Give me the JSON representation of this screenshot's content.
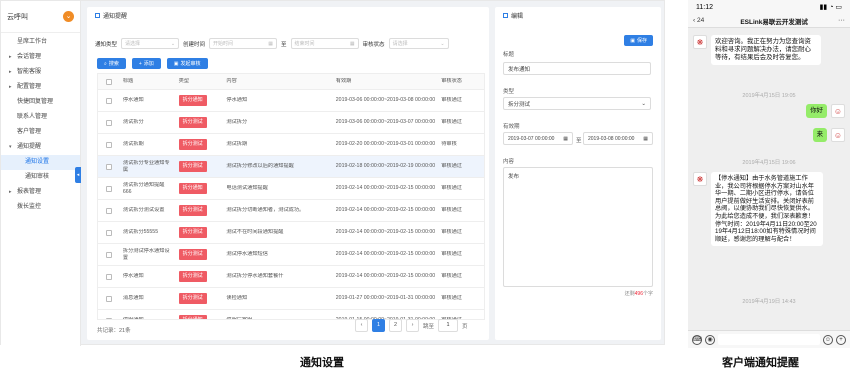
{
  "sidebar": {
    "brand": "云呼叫",
    "badge": "⌄",
    "items": [
      {
        "label": "呈席工作台",
        "arrow": ""
      },
      {
        "label": "会话管理",
        "arrow": "▸"
      },
      {
        "label": "智能客服",
        "arrow": "▸"
      },
      {
        "label": "配置管理",
        "arrow": "▸"
      },
      {
        "label": "快捷回复管理",
        "arrow": ""
      },
      {
        "label": "联系人管理",
        "arrow": ""
      },
      {
        "label": "客户管理",
        "arrow": ""
      },
      {
        "label": "通知提醒",
        "arrow": "▾"
      },
      {
        "label": "通知设置",
        "arrow": ""
      },
      {
        "label": "通知审核",
        "arrow": ""
      },
      {
        "label": "报表管理",
        "arrow": "▸"
      },
      {
        "label": "拨长监控",
        "arrow": ""
      }
    ]
  },
  "main": {
    "title": "通知提醒",
    "filters": {
      "type_label": "通知类型",
      "type_ph": "请选择",
      "create_label": "创建时间",
      "start_ph": "开始时间",
      "to": "至",
      "end_ph": "结束时间",
      "review_label": "审核状态",
      "review_ph": "请选择"
    },
    "buttons": {
      "search": "搜索",
      "add": "添加",
      "publish": "发起审核"
    },
    "columns": [
      "",
      "标题",
      "类型",
      "内容",
      "有效期",
      "审核状态"
    ],
    "rows": [
      {
        "title": "停水通知",
        "type": "拆分通知",
        "content": "停水通知",
        "period": "2019-03-06 00:00:00~2019-03-08 00:00:00",
        "status": "审核通过"
      },
      {
        "title": "测试拆分",
        "type": "拆分测试",
        "content": "测试拆分",
        "period": "2019-03-06 00:00:00~2019-03-07 00:00:00",
        "status": "审核通过"
      },
      {
        "title": "测试拆期",
        "type": "拆分测试",
        "content": "测试拆期",
        "period": "2019-02-20 00:00:00~2019-03-01 00:00:00",
        "status": "待审核"
      },
      {
        "title": "测试拆分专业通知专属",
        "type": "拆分测试",
        "content": "测试拆分修改以后的通知提醒",
        "period": "2019-02-18 00:00:00~2019-02-19 00:00:00",
        "status": "审核通过"
      },
      {
        "title": "测试拆分通知提醒666",
        "type": "拆分通知",
        "content": "电话测试通知提醒",
        "period": "2019-02-14 00:00:00~2019-02-15 00:00:00",
        "status": "审核通过"
      },
      {
        "title": "测试拆分测试设置",
        "type": "拆分测试",
        "content": "测试拆分切断通知者，测试成功。",
        "period": "2019-02-14 00:00:00~2019-02-15 00:00:00",
        "status": "审核通过"
      },
      {
        "title": "测试拆分55555",
        "type": "拆分测试",
        "content": "测试不在时间段通知提醒",
        "period": "2019-02-14 00:00:00~2019-02-15 00:00:00",
        "status": "审核通过"
      },
      {
        "title": "拆分测试停水通知设置",
        "type": "拆分测试",
        "content": "测试停水通知短信",
        "period": "2019-02-14 00:00:00~2019-02-15 00:00:00",
        "status": "审核通过"
      },
      {
        "title": "停水通知",
        "type": "拆分测试",
        "content": "测试拆分停水通知套餐什",
        "period": "2019-02-14 00:00:00~2019-02-15 00:00:00",
        "status": "审核通过"
      },
      {
        "title": "消息通知",
        "type": "拆分测试",
        "content": "读检通知",
        "period": "2019-01-27 00:00:00~2019-01-31 00:00:00",
        "status": "审核通过"
      },
      {
        "title": "停服通知",
        "type": "拆分通知",
        "content": "停服厂客服",
        "period": "2019-01-15 00:00:00~2019-01-31 00:00:00",
        "status": "审核通过"
      }
    ],
    "total": "共记录：21条",
    "pager": {
      "prev": "‹",
      "p1": "1",
      "p2": "2",
      "next": "›",
      "goto": "跳至",
      "page": "1",
      "unit": "页"
    }
  },
  "form": {
    "title": "编辑",
    "save": "保存",
    "f_title_label": "标题",
    "f_title_value": "发布通知",
    "f_type_label": "类型",
    "f_type_value": "拆分测试",
    "f_period_label": "有效期",
    "f_start": "2019-03-07 00:00:00",
    "f_to": "至",
    "f_end": "2019-03-08 00:00:00",
    "f_content_label": "内容",
    "f_content_value": "发布",
    "counter_pre": "还剩",
    "counter_num": "496",
    "counter_post": "个字"
  },
  "phone": {
    "time": "11:12",
    "signal": "▮▮ ◔ ▭",
    "back": "‹ 24",
    "title": "ESLink易联云开发测试",
    "more": "···",
    "msg1": "欢迎咨询。我正在努力为您查询资料和寻求问题解决办法，请您耐心等待，有结果后会及时答复您。",
    "time1": "2019年4月15日 19:05",
    "msg2": "你好",
    "msg3": "来",
    "time2": "2019年4月15日 19:06",
    "msg4": "【停水通知】由于水务管道施工作业，我公司将根据停水方案对山水年华一期、二期小区进行停水，请各位用户提前做好生活安排。关闭好表前总阀，以便协助我们尽快恢复供水。为此给您造成不便，我们深表歉意！停气时间：2019年4月11日20:00至2019年4月12日18:00如有特殊情况时间顺延，感谢您的理解与配合！",
    "time3": "2019年4月19日 14:43"
  },
  "captions": {
    "left": "通知设置",
    "right": "客户端通知提醒"
  },
  "colors": {
    "primary": "#2f7fe4",
    "tag": "#ef5b64",
    "bubble_green": "#95ec69",
    "badge": "#f08c26"
  }
}
